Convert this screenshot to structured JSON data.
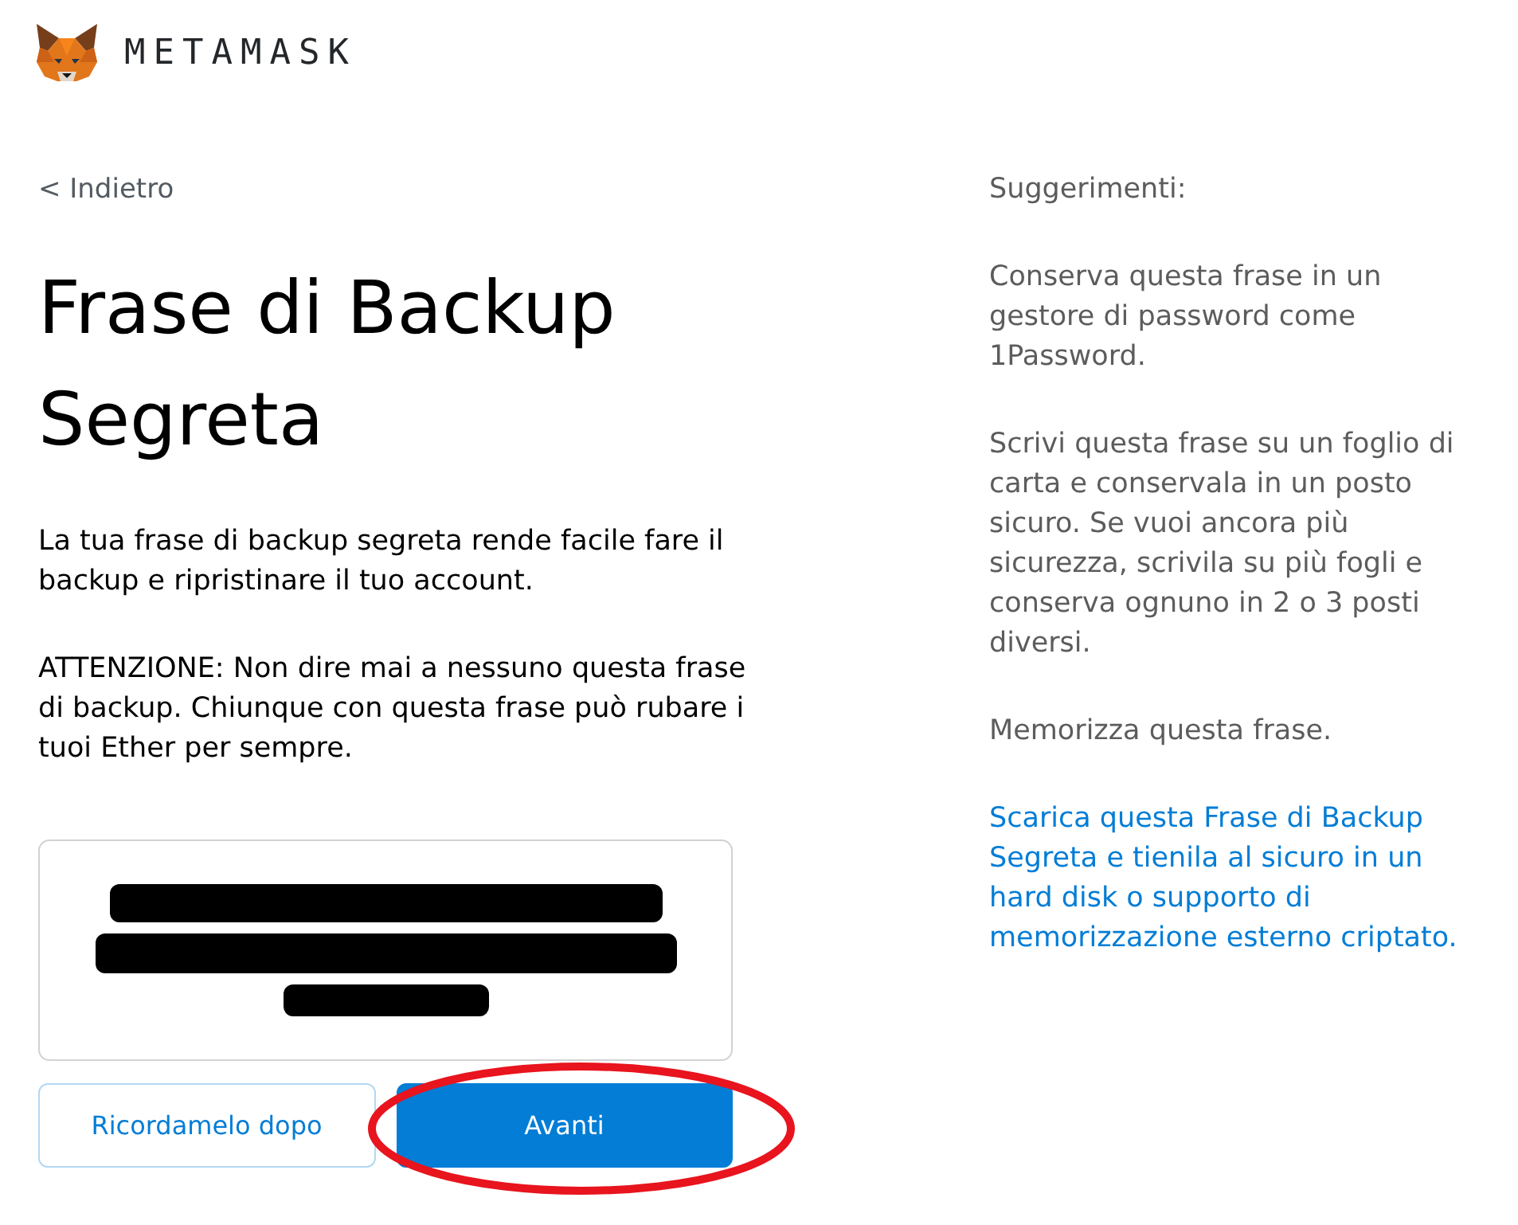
{
  "header": {
    "brand": "METAMASK"
  },
  "back_link": {
    "label": "< Indietro"
  },
  "title": "Frase di Backup Segreta",
  "paragraphs": [
    "La tua frase di backup segreta rende facile fare il backup e ripristinare il tuo account.",
    "ATTENZIONE: Non dire mai a nessuno questa frase di backup. Chiunque con questa frase può rubare i tuoi Ether per sempre."
  ],
  "secret_phrase": {
    "redacted": true
  },
  "buttons": [
    {
      "label": "Ricordamelo dopo",
      "kind": "secondary",
      "highlighted": false
    },
    {
      "label": "Avanti",
      "kind": "primary",
      "highlighted": true
    }
  ],
  "tips": {
    "title": "Suggerimenti:",
    "items": [
      {
        "kind": "text",
        "text": "Conserva questa frase in un gestore di password come 1Password."
      },
      {
        "kind": "text",
        "text": "Scrivi questa frase su un foglio di carta e conservala in un posto sicuro. Se vuoi ancora più sicurezza, scrivila su più fogli e conserva ognuno in 2 o 3 posti diversi."
      },
      {
        "kind": "text",
        "text": "Memorizza questa frase."
      },
      {
        "kind": "link",
        "text": "Scarica questa Frase di Backup Segreta e tienila al sicuro in un hard disk o supporto di memorizzazione esterno criptato."
      }
    ]
  }
}
